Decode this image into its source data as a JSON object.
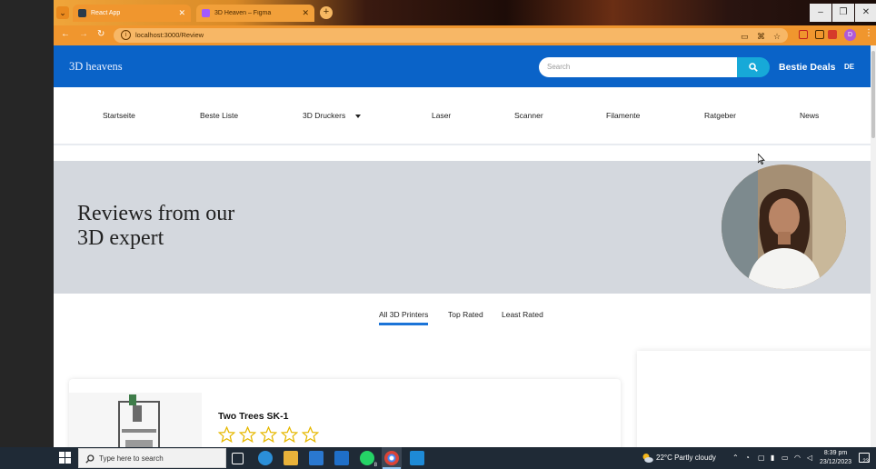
{
  "browser": {
    "tabs": [
      {
        "title": "React App",
        "active": true
      },
      {
        "title": "3D Heaven – Figma",
        "active": false
      }
    ],
    "new_tab_symbol": "+",
    "url": "localhost:3000/Review",
    "window_controls": [
      "–",
      "❐",
      "✕"
    ],
    "profile_initial": "D"
  },
  "header": {
    "brand": "3D heavens",
    "search_placeholder": "Search",
    "deals": "Bestie Deals",
    "lang": "DE"
  },
  "nav": {
    "items": [
      "Startseite",
      "Beste Liste",
      "3D Druckers",
      "Laser",
      "Scanner",
      "Filamente",
      "Ratgeber",
      "News"
    ]
  },
  "hero": {
    "title_line1": "Reviews from our",
    "title_line2": "3D expert"
  },
  "review_tabs": [
    "All 3D Printers",
    "Top Rated",
    "Least Rated"
  ],
  "product": {
    "name": "Two Trees SK-1",
    "rating": 0,
    "max_rating": 5
  },
  "taskbar": {
    "search_placeholder": "Type here to search",
    "weather": "22°C  Partly cloudy",
    "time": "8:39 pm",
    "date": "23/12/2023",
    "notifications": "23",
    "whatsapp_badge": "8"
  },
  "colors": {
    "header_blue": "#0a63c8",
    "search_button": "#17a9d8",
    "hero_bg": "#d4d8de",
    "active_tab_underline": "#1b74d8",
    "chrome_orange": "#f0962e"
  }
}
